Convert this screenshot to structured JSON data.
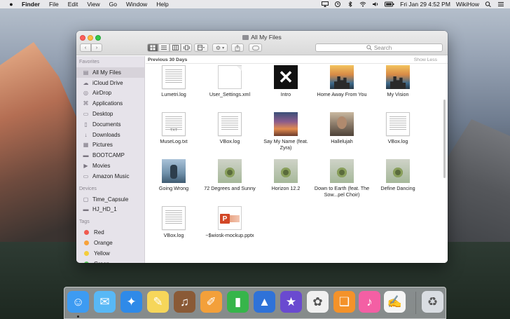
{
  "menubar": {
    "apple_icon": "apple-logo",
    "app": "Finder",
    "menus": [
      "File",
      "Edit",
      "View",
      "Go",
      "Window",
      "Help"
    ],
    "status": {
      "datetime": "Fri Jan 29  4:52 PM",
      "user": "WikiHow",
      "icons": [
        "airplay-icon",
        "time-machine-icon",
        "bluetooth-icon",
        "wifi-icon",
        "volume-icon",
        "battery-icon",
        "spotlight-icon",
        "menu-list-icon"
      ]
    }
  },
  "window": {
    "title": "All My Files",
    "search_placeholder": "Search",
    "section_title": "Previous 30 Days",
    "show_less": "Show Less"
  },
  "sidebar": {
    "favorites_label": "Favorites",
    "favorites": [
      {
        "label": "All My Files",
        "icon": "all-files-icon",
        "selected": true
      },
      {
        "label": "iCloud Drive",
        "icon": "cloud-icon"
      },
      {
        "label": "AirDrop",
        "icon": "airdrop-icon"
      },
      {
        "label": "Applications",
        "icon": "applications-icon"
      },
      {
        "label": "Desktop",
        "icon": "desktop-icon"
      },
      {
        "label": "Documents",
        "icon": "documents-icon"
      },
      {
        "label": "Downloads",
        "icon": "downloads-icon"
      },
      {
        "label": "Pictures",
        "icon": "pictures-icon"
      },
      {
        "label": "BOOTCAMP",
        "icon": "drive-icon"
      },
      {
        "label": "Movies",
        "icon": "movies-icon"
      },
      {
        "label": "Amazon Music",
        "icon": "folder-icon"
      }
    ],
    "devices_label": "Devices",
    "devices": [
      {
        "label": "Time_Capsule",
        "icon": "time-capsule-icon"
      },
      {
        "label": "HJ_HD_1",
        "icon": "drive-icon"
      }
    ],
    "tags_label": "Tags",
    "tags": [
      {
        "label": "Red",
        "color": "#f05a4f"
      },
      {
        "label": "Orange",
        "color": "#f7a23b"
      },
      {
        "label": "Yellow",
        "color": "#f4cd3b"
      },
      {
        "label": "Green",
        "color": "#57c15a"
      }
    ]
  },
  "files": [
    {
      "name": "Lumetri.log",
      "thumb": "doc"
    },
    {
      "name": "User_Settings.xml",
      "thumb": "blank"
    },
    {
      "name": "Intro",
      "thumb": "x"
    },
    {
      "name": "Home Away From You",
      "thumb": "photo-city"
    },
    {
      "name": "My Vision",
      "thumb": "photo-city"
    },
    {
      "name": "MuseLog.txt",
      "thumb": "doc",
      "badge": "TXT"
    },
    {
      "name": "VBox.log",
      "thumb": "doc"
    },
    {
      "name": "Say My Name (feat. Zyra)",
      "thumb": "sunset"
    },
    {
      "name": "Hallelujah",
      "thumb": "portrait"
    },
    {
      "name": "VBox.log",
      "thumb": "doc"
    },
    {
      "name": "Going Wrong",
      "thumb": "going"
    },
    {
      "name": "72 Degrees and Sunny",
      "thumb": "cover"
    },
    {
      "name": "Horizon 12.2",
      "thumb": "cover"
    },
    {
      "name": "Down to Earth (feat. The Sow...pel Choir)",
      "thumb": "cover"
    },
    {
      "name": "Define Dancing",
      "thumb": "cover"
    },
    {
      "name": "VBox.log",
      "thumb": "doc"
    },
    {
      "name": "~$wiosk-mockup.pptx",
      "thumb": "ppt"
    }
  ],
  "dock": [
    {
      "name": "finder-icon",
      "color": "#3d9bf2",
      "glyph": "☺"
    },
    {
      "name": "messages-icon",
      "color": "#58b8f6",
      "glyph": "✉"
    },
    {
      "name": "safari-icon",
      "color": "#2f8ae8",
      "glyph": "✦"
    },
    {
      "name": "notes-icon",
      "color": "#f6d65a",
      "glyph": "✎"
    },
    {
      "name": "garageband-icon",
      "color": "#8a5a36",
      "glyph": "♫"
    },
    {
      "name": "pages-icon",
      "color": "#f3a03a",
      "glyph": "✐"
    },
    {
      "name": "numbers-icon",
      "color": "#36b54a",
      "glyph": "▮"
    },
    {
      "name": "keynote-icon",
      "color": "#2f72d8",
      "glyph": "▲"
    },
    {
      "name": "imovie-icon",
      "color": "#6a4ad0",
      "glyph": "★"
    },
    {
      "name": "photos-icon",
      "color": "#f0f0f0",
      "glyph": "✿"
    },
    {
      "name": "ibooks-icon",
      "color": "#f4922a",
      "glyph": "❑"
    },
    {
      "name": "itunes-icon",
      "color": "#f45fa4",
      "glyph": "♪"
    },
    {
      "name": "textedit-icon",
      "color": "#f5f5f5",
      "glyph": "✍"
    },
    {
      "name": "trash-icon",
      "color": "#d9dde2",
      "glyph": "♻"
    }
  ]
}
